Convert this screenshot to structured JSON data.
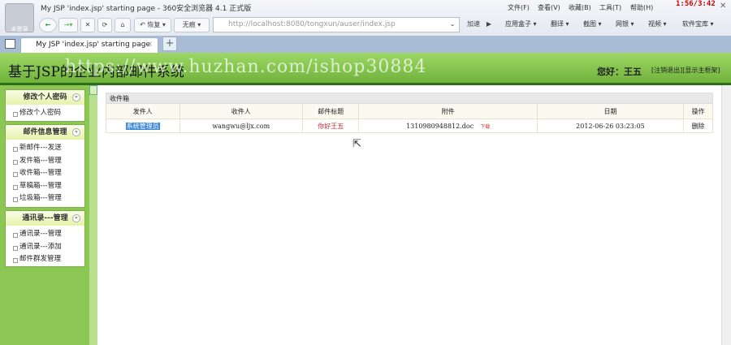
{
  "browser": {
    "window_title": "My JSP 'index.jsp' starting page - 360安全浏览器 4.1 正式版",
    "avatar_label": "未登录",
    "menu": [
      "文件(F)",
      "查看(V)",
      "收藏(B)",
      "工具(T)",
      "帮助(H)"
    ],
    "clock": "1:56/3:42",
    "restore": "↶ 恢复 ▾",
    "traceless": "无痕 ▾",
    "address": "http://localhost:8080/tongxun/auser/index.jsp",
    "address_host": "localhost",
    "accelerate": "加速",
    "toolbar": [
      "应用盒子 ▾",
      "翻译 ▾",
      "截图 ▾",
      "网银 ▾",
      "视频 ▾",
      "软件宝库 ▾"
    ],
    "tab_title": "My JSP 'index.jsp' starting page"
  },
  "header": {
    "title": "基于JSP的企业内部邮件系统",
    "watermark": "https://www.huzhan.com/ishop30884",
    "greeting": "您好：王五",
    "logout": "[注销退出]",
    "show_frame": "[显示主框架]"
  },
  "sidebar": [
    {
      "title": "修改个人密码",
      "items": [
        "修改个人密码"
      ]
    },
    {
      "title": "邮件信息管理",
      "items": [
        "新邮件---发送",
        "发件箱---管理",
        "收件箱---管理",
        "草稿箱---管理",
        "垃圾箱---管理"
      ]
    },
    {
      "title": "通讯录---管理",
      "items": [
        "通讯录---管理",
        "通讯录---添加",
        "邮件群发管理"
      ]
    }
  ],
  "inbox": {
    "caption": "收件箱",
    "columns": [
      "发件人",
      "收件人",
      "邮件标题",
      "附件",
      "日期",
      "操作"
    ],
    "rows": [
      {
        "sender": "系统管理员",
        "recipient": "wangwu@ljx.com",
        "subject": "你好王五",
        "attachment": "1310980948812.doc",
        "download": "下载",
        "date": "2012-06-26 03:23:05",
        "action": "删除"
      }
    ]
  }
}
